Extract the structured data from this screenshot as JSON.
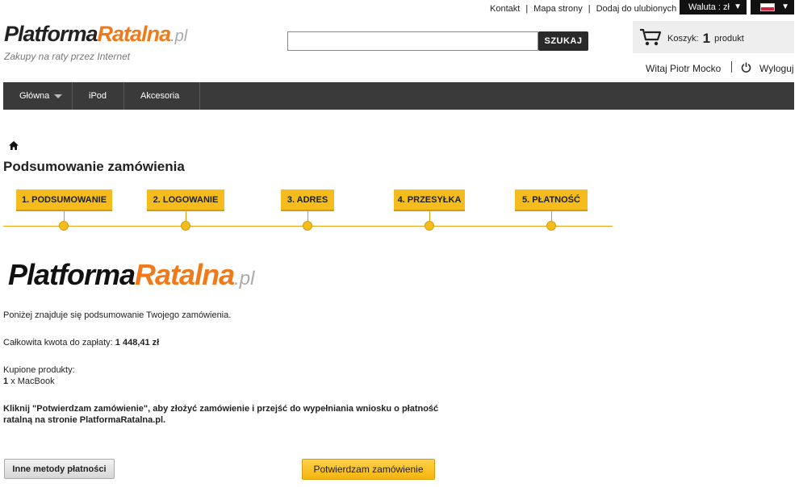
{
  "toplinks": {
    "contact": "Kontakt",
    "sitemap": "Mapa strony",
    "favorites": "Dodaj do ulubionych"
  },
  "currency": {
    "label": "Waluta : zł"
  },
  "logo": {
    "black": "Platforma",
    "orange": "Ratalna",
    "suffix": ".pl",
    "tagline": "Zakupy na raty przez Internet"
  },
  "search": {
    "value": "",
    "placeholder": "",
    "button": "SZUKAJ"
  },
  "cart": {
    "label": "Koszyk:",
    "count": "1",
    "unit": "produkt"
  },
  "user": {
    "welcome": "Witaj Piotr Mocko",
    "logout": "Wyloguj"
  },
  "nav": {
    "items": [
      {
        "label": "Główna"
      },
      {
        "label": "iPod"
      },
      {
        "label": "Akcesoria"
      }
    ]
  },
  "page": {
    "title": "Podsumowanie zamówienia"
  },
  "steps": [
    {
      "label": "1. PODSUMOWANIE"
    },
    {
      "label": "2. LOGOWANIE"
    },
    {
      "label": "3. ADRES"
    },
    {
      "label": "4. PRZESYŁKA"
    },
    {
      "label": "5. PŁATNOŚĆ"
    }
  ],
  "summary": {
    "intro": "Poniżej znajduje się podsumowanie Twojego zamówienia.",
    "total_label": "Całkowita kwota do zapłaty:",
    "total_value": "1 448,41 zł",
    "products_label": "Kupione produkty:",
    "product_qty": "1",
    "product_name": "x MacBook",
    "confirm_note": "Kliknij \"Potwierdzam zamówienie\", aby złożyć zamówienie i przejść do wypełniania wniosku o płatność ratalną na stronie PlatformaRatalna.pl."
  },
  "buttons": {
    "other_methods": "Inne metody płatności",
    "confirm": "Potwierdzam zamówienie"
  },
  "colors": {
    "accent": "#f5bc1d",
    "brand_orange": "#f07a1a",
    "nav_bg": "#3a3a3a"
  }
}
